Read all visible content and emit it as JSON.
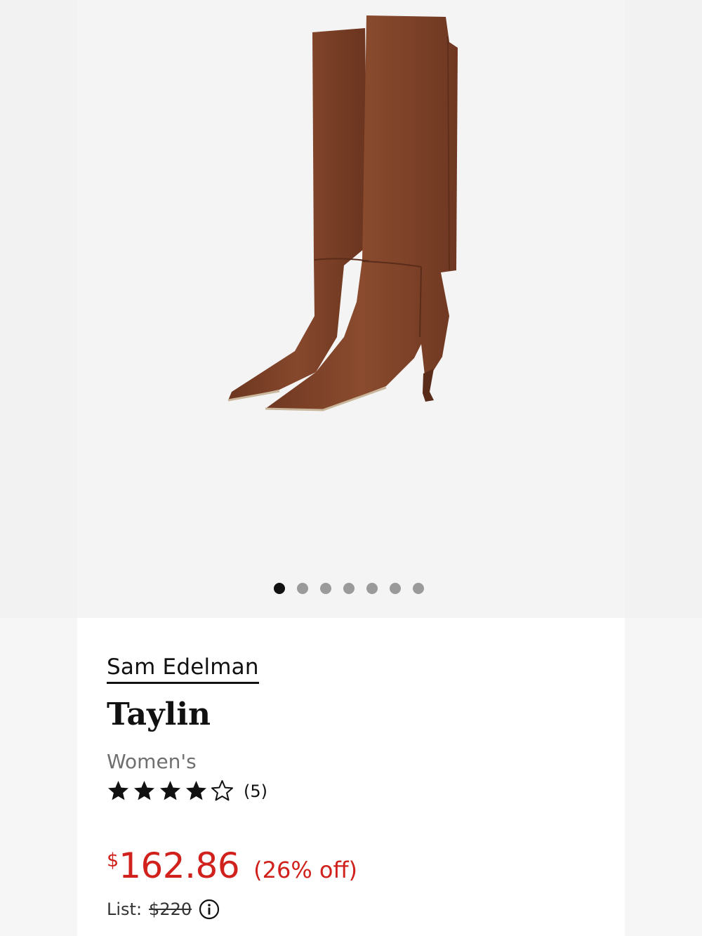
{
  "product": {
    "brand": "Sam Edelman",
    "name": "Taylin",
    "gender": "Women's",
    "rating": 4,
    "rating_max": 5,
    "review_count": "(5)",
    "currency_symbol": "$",
    "price": "162.86",
    "discount": "(26% off)",
    "list_label": "List:",
    "list_price": "$220"
  },
  "gallery": {
    "image_count": 7,
    "active_index": 0
  },
  "colors": {
    "sale_red": "#d0211c",
    "boot_brown": "#7a3f26",
    "text_dark": "#111111"
  }
}
